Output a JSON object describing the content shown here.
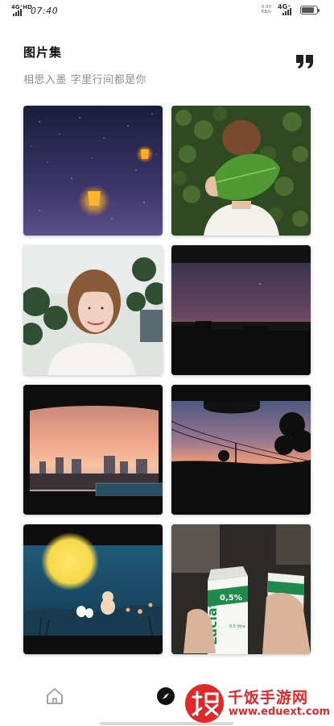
{
  "status_bar": {
    "network_left": "4G⁺HD",
    "time": "07:40",
    "speed_value": "0.00",
    "speed_unit": "KB/s",
    "network_right": "4G⁺",
    "battery_level": 0.85
  },
  "header": {
    "title": "图片集",
    "subtitle": "相思入墨 字里行间都是你"
  },
  "gallery": {
    "images": [
      {
        "name": "sky-lanterns-night"
      },
      {
        "name": "girl-holding-leaf"
      },
      {
        "name": "smiling-girl-portrait"
      },
      {
        "name": "dusk-skyline-dark"
      },
      {
        "name": "sunset-city-through-car-window"
      },
      {
        "name": "sunset-power-lines"
      },
      {
        "name": "moon-cartoon-rabbits"
      },
      {
        "name": "hands-holding-milk-cartons"
      }
    ],
    "milk_label": "Łaciate",
    "milk_percent": "0,5%",
    "milk_volume": "0,5 litra"
  },
  "watermark": {
    "text": "千饭手游网",
    "url": "www.eduext.com"
  },
  "colors": {
    "accent": "#e02828",
    "subtitle": "#8e8e8e",
    "icon": "#222222"
  }
}
